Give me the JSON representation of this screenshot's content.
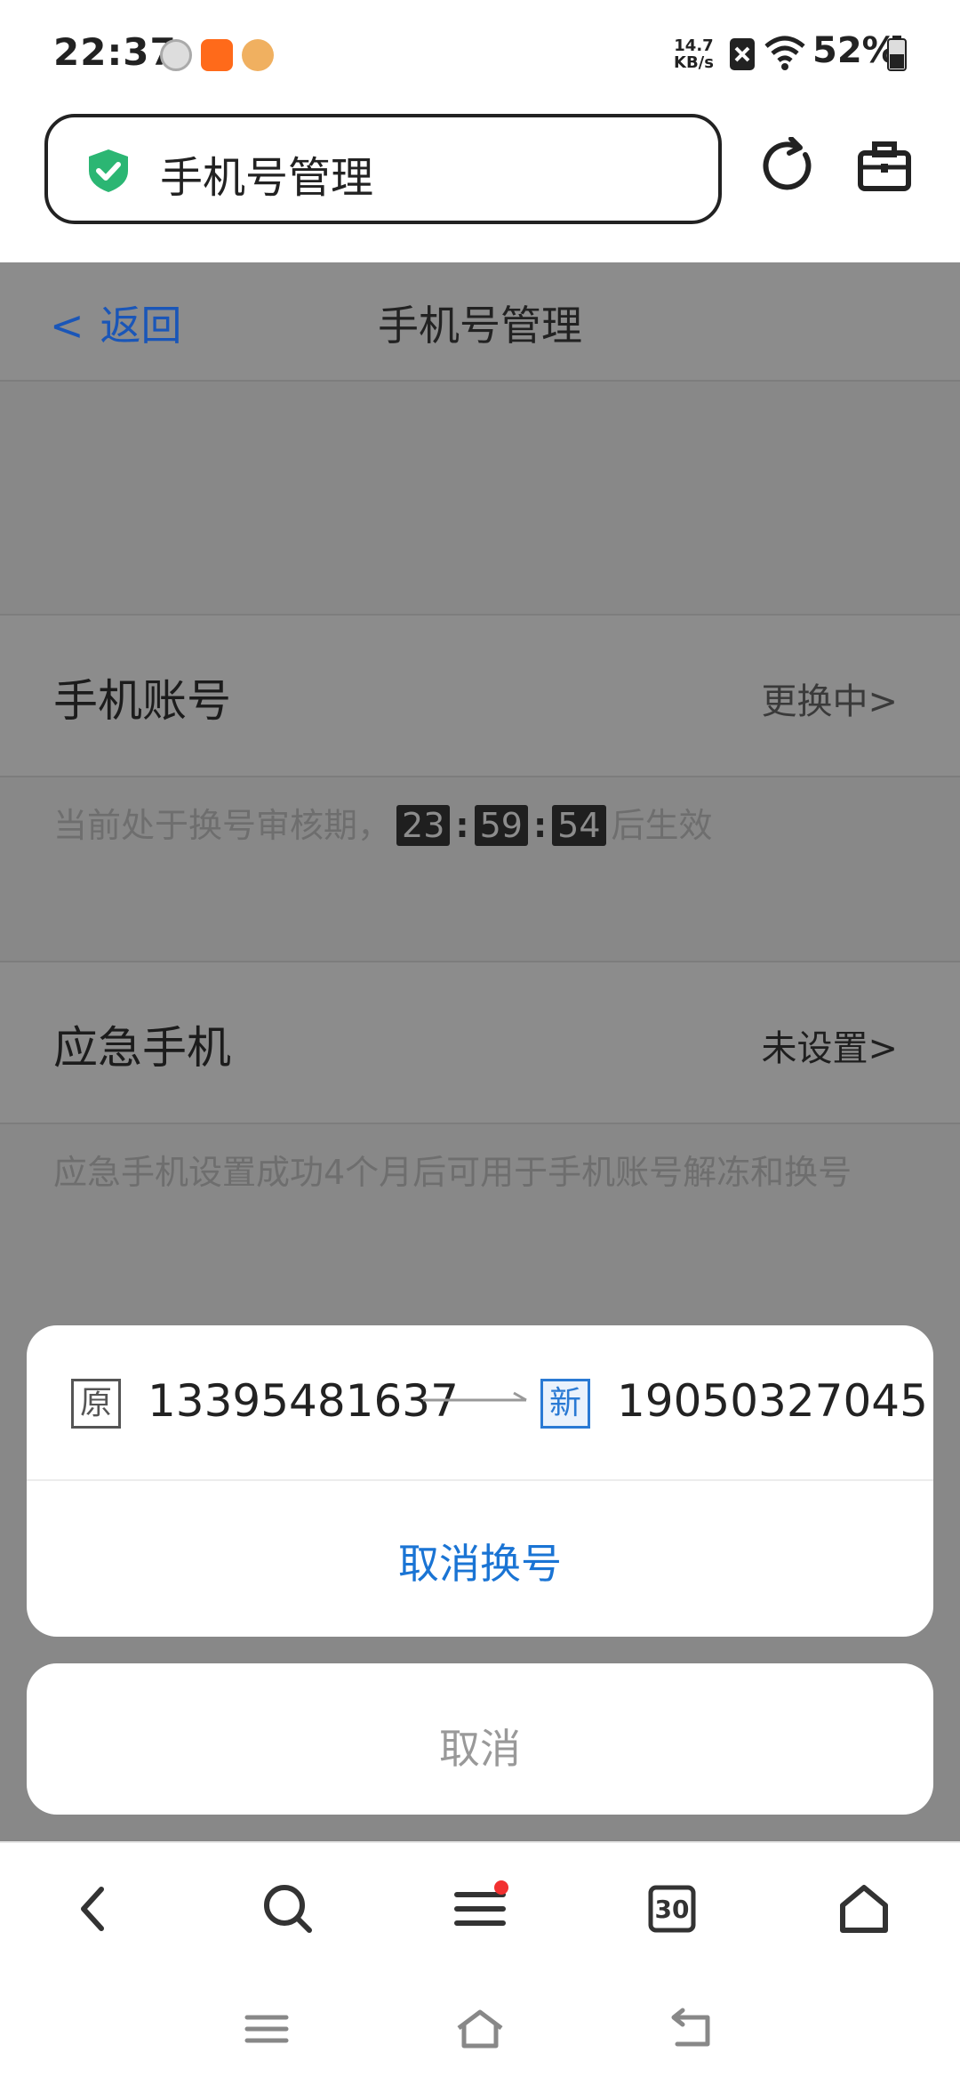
{
  "status_bar": {
    "time": "22:37",
    "network_speed_value": "14.7",
    "network_speed_unit": "KB/s",
    "battery_percent": "52%"
  },
  "browser": {
    "url_title": "手机号管理"
  },
  "page": {
    "back_label": "返回",
    "title": "手机号管理",
    "phone_account": {
      "label": "手机账号",
      "value": "更换中>",
      "note_prefix": "当前处于换号审核期，",
      "countdown": {
        "hours": "23",
        "sep1": ":",
        "minutes": "59",
        "sep2": ":",
        "seconds": "54"
      },
      "note_suffix": "后生效"
    },
    "emergency_phone": {
      "label": "应急手机",
      "value": "未设置>",
      "note": "应急手机设置成功4个月后可用于手机账号解冻和换号"
    }
  },
  "sheet": {
    "old_tag": "原",
    "old_number": "13395481637",
    "new_tag": "新",
    "new_number": "19050327045",
    "action_label": "取消换号",
    "cancel_label": "取消"
  },
  "bottom_bar": {
    "tabs_count": "30"
  },
  "colors": {
    "accent": "#1a74d4",
    "back_link": "#1a56b8",
    "shield_green": "#2bb673",
    "badge_red": "#f23030"
  }
}
